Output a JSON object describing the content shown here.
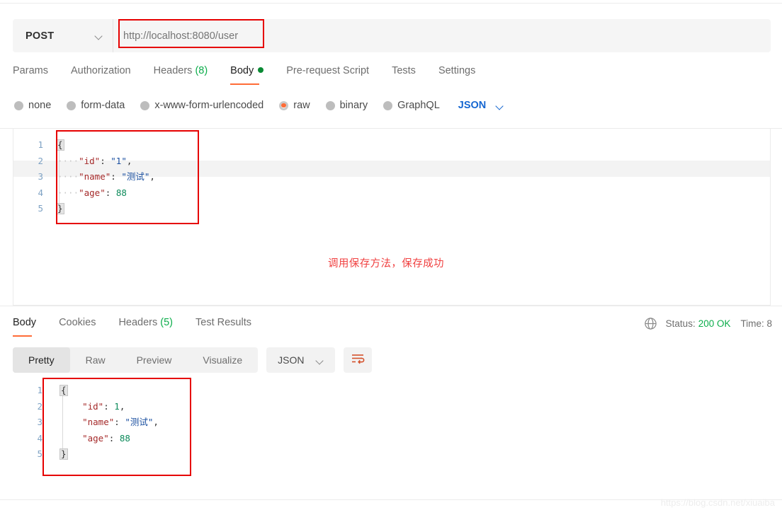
{
  "request": {
    "method": "POST",
    "url_value": "http://localhost:8080/user",
    "tabs": [
      {
        "label": "Params",
        "count": "",
        "active": false,
        "dot": false
      },
      {
        "label": "Authorization",
        "count": "",
        "active": false,
        "dot": false
      },
      {
        "label": "Headers",
        "count": "(8)",
        "active": false,
        "dot": false
      },
      {
        "label": "Body",
        "count": "",
        "active": true,
        "dot": true
      },
      {
        "label": "Pre-request Script",
        "count": "",
        "active": false,
        "dot": false
      },
      {
        "label": "Tests",
        "count": "",
        "active": false,
        "dot": false
      },
      {
        "label": "Settings",
        "count": "",
        "active": false,
        "dot": false
      }
    ],
    "body_types": [
      {
        "label": "none",
        "selected": false
      },
      {
        "label": "form-data",
        "selected": false
      },
      {
        "label": "x-www-form-urlencoded",
        "selected": false
      },
      {
        "label": "raw",
        "selected": true
      },
      {
        "label": "binary",
        "selected": false
      },
      {
        "label": "GraphQL",
        "selected": false
      }
    ],
    "format": "JSON",
    "body_lines": [
      {
        "num": "1",
        "brace": "{",
        "text": ""
      },
      {
        "num": "2",
        "indent": "····",
        "key": "\"id\"",
        "colon": ": ",
        "value": "\"1\"",
        "vtype": "s",
        "tail": ","
      },
      {
        "num": "3",
        "indent": "····",
        "key": "\"name\"",
        "colon": ": ",
        "value": "\"测试\"",
        "vtype": "s",
        "tail": ","
      },
      {
        "num": "4",
        "indent": "····",
        "key": "\"age\"",
        "colon": ": ",
        "value": "88",
        "vtype": "n",
        "tail": ""
      },
      {
        "num": "5",
        "brace": "}",
        "text": ""
      }
    ]
  },
  "annotation": {
    "text": "调用保存方法，保存成功",
    "color": "#f04040"
  },
  "response": {
    "tabs": [
      {
        "label": "Body",
        "count": "",
        "active": true
      },
      {
        "label": "Cookies",
        "count": "",
        "active": false
      },
      {
        "label": "Headers",
        "count": "(5)",
        "active": false
      },
      {
        "label": "Test Results",
        "count": "",
        "active": false
      }
    ],
    "status_label": "Status:",
    "status_value": "200 OK",
    "time_label": "Time: 8",
    "view_modes": [
      {
        "label": "Pretty",
        "active": true
      },
      {
        "label": "Raw",
        "active": false
      },
      {
        "label": "Preview",
        "active": false
      },
      {
        "label": "Visualize",
        "active": false
      }
    ],
    "format": "JSON",
    "body_lines": [
      {
        "num": "1",
        "brace": "{",
        "text": ""
      },
      {
        "num": "2",
        "indent": "    ",
        "key": "\"id\"",
        "colon": ": ",
        "value": "1",
        "vtype": "n",
        "tail": ","
      },
      {
        "num": "3",
        "indent": "    ",
        "key": "\"name\"",
        "colon": ": ",
        "value": "\"测试\"",
        "vtype": "s",
        "tail": ","
      },
      {
        "num": "4",
        "indent": "    ",
        "key": "\"age\"",
        "colon": ": ",
        "value": "88",
        "vtype": "n",
        "tail": ""
      },
      {
        "num": "5",
        "brace": "}",
        "text": ""
      }
    ]
  },
  "watermark": "https://blog.csdn.net/xiuaiba"
}
